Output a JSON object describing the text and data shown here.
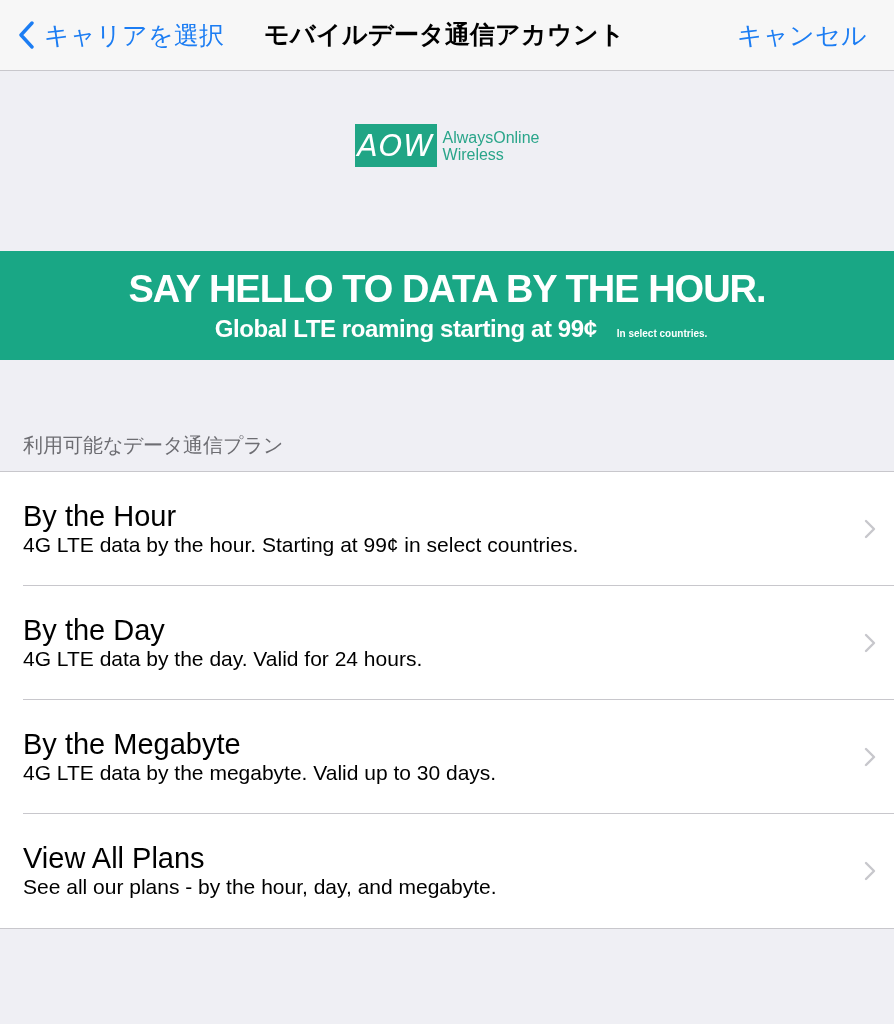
{
  "nav": {
    "back_label": "キャリアを選択",
    "title": "モバイルデータ通信アカウント",
    "cancel_label": "キャンセル"
  },
  "logo": {
    "mark": "AOW",
    "name": "AlwaysOnline",
    "tagline": "Wireless"
  },
  "banner": {
    "headline": "SAY HELLO TO DATA BY THE HOUR.",
    "subline": "Global LTE roaming starting at 99¢",
    "note": "In select countries."
  },
  "section_header": "利用可能なデータ通信プラン",
  "plans": [
    {
      "title": "By the Hour",
      "description": "4G LTE data by the hour. Starting at 99¢ in select countries."
    },
    {
      "title": "By the Day",
      "description": "4G LTE data by the day. Valid for 24 hours."
    },
    {
      "title": "By the Megabyte",
      "description": "4G LTE data by the megabyte. Valid up to 30 days."
    },
    {
      "title": "View All Plans",
      "description": "See all our plans - by the hour, day, and megabyte."
    }
  ]
}
